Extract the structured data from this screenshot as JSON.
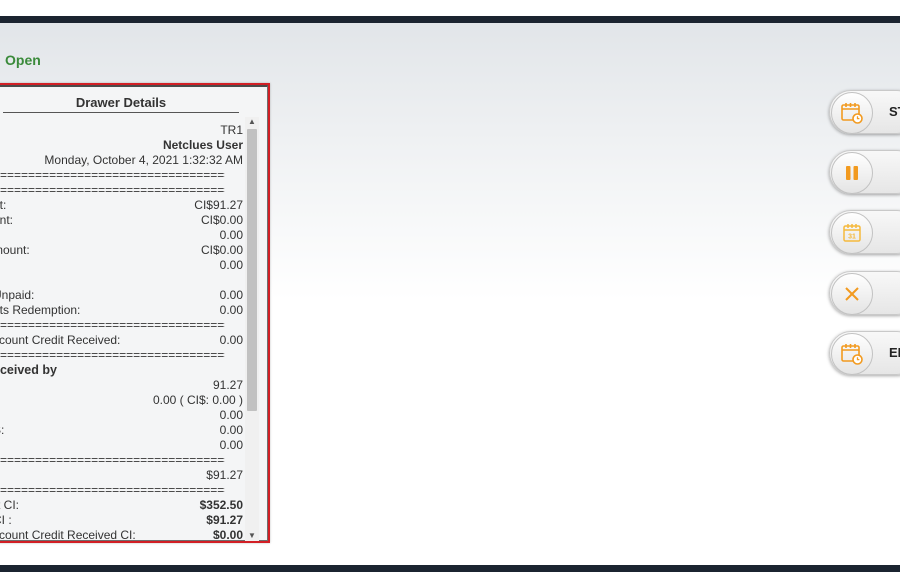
{
  "status": {
    "label": "Open"
  },
  "drawer": {
    "title": "Drawer Details",
    "lines": [
      {
        "label": "",
        "value": "TR1"
      },
      {
        "label": ":",
        "value": "Netclues User",
        "bold": true
      },
      {
        "label": "",
        "value": "Monday, October 4, 2021 1:32:32 AM"
      },
      {
        "sep": "=============================================="
      },
      {
        "sep": "=============================================="
      },
      {
        "label": "nt:",
        "value": "CI$91.27"
      },
      {
        "label": "unt:",
        "value": "CI$0.00"
      },
      {
        "label": "",
        "value": "0.00"
      },
      {
        "label": "mount:",
        "value": "CI$0.00"
      },
      {
        "label": "",
        "value": "0.00"
      },
      {
        "label": "",
        "value": ""
      },
      {
        "label": "Unpaid:",
        "value": "0.00"
      },
      {
        "label": "nts Redemption:",
        "value": "0.00"
      },
      {
        "sep": "=============================================="
      },
      {
        "label": "ccount Credit Received:",
        "value": "0.00"
      },
      {
        "sep": "=============================================="
      },
      {
        "label": "eceived by",
        "value": "",
        "heading": true
      },
      {
        "label": "",
        "value": "91.27"
      },
      {
        "label": ":",
        "value": "0.00 ( CI$: 0.00 )"
      },
      {
        "label": "",
        "value": "0.00"
      },
      {
        "label": "S:",
        "value": "0.00"
      },
      {
        "label": "",
        "value": "0.00"
      },
      {
        "sep": "=============================================="
      },
      {
        "label": "",
        "value": "$91.27"
      },
      {
        "sep": "=============================================="
      },
      {
        "label": "rt CI:",
        "value": "$352.50",
        "bold": true
      },
      {
        "label": "CI :",
        "value": "$91.27",
        "bold": true
      },
      {
        "label": "ccount Credit Received CI:",
        "value": "$0.00",
        "bold": true
      }
    ]
  },
  "actions": [
    {
      "name": "start-button",
      "label": "ST",
      "icon": "calendar-clock-icon"
    },
    {
      "name": "pause-button",
      "label": "",
      "icon": "pause-icon"
    },
    {
      "name": "calendar-button",
      "label": "",
      "icon": "calendar-31-icon"
    },
    {
      "name": "cancel-button",
      "label": "",
      "icon": "close-icon"
    },
    {
      "name": "end-button",
      "label": "EN",
      "icon": "calendar-clock-icon"
    }
  ],
  "colors": {
    "accent_orange": "#f29a1f",
    "panel_border": "#d21f25",
    "status_green": "#3a8a3a",
    "bar_dark": "#1b2430"
  }
}
